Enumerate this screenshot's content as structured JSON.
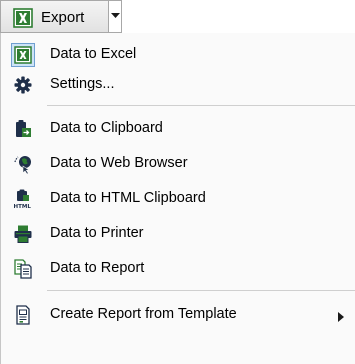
{
  "split_button": {
    "label": "Export",
    "icon": "excel-export-icon"
  },
  "menu": {
    "group1": [
      {
        "label": "Data to Excel",
        "icon": "excel-icon"
      },
      {
        "label": "Settings...",
        "icon": "gear-icon"
      }
    ],
    "group2": [
      {
        "label": "Data to Clipboard",
        "icon": "clipboard-icon"
      },
      {
        "label": "Data to Web Browser",
        "icon": "web-browser-icon"
      },
      {
        "label": "Data to HTML Clipboard",
        "icon": "html-clipboard-icon"
      },
      {
        "label": "Data to Printer",
        "icon": "printer-icon"
      },
      {
        "label": "Data to Report",
        "icon": "report-icon"
      }
    ],
    "group3": [
      {
        "label": "Create Report from Template",
        "icon": "report-template-icon",
        "submenu_indicator": "▶"
      }
    ]
  },
  "colors": {
    "green": "#2e7d32",
    "dark": "#1f2f4a",
    "highlight": "#cde3f7"
  }
}
